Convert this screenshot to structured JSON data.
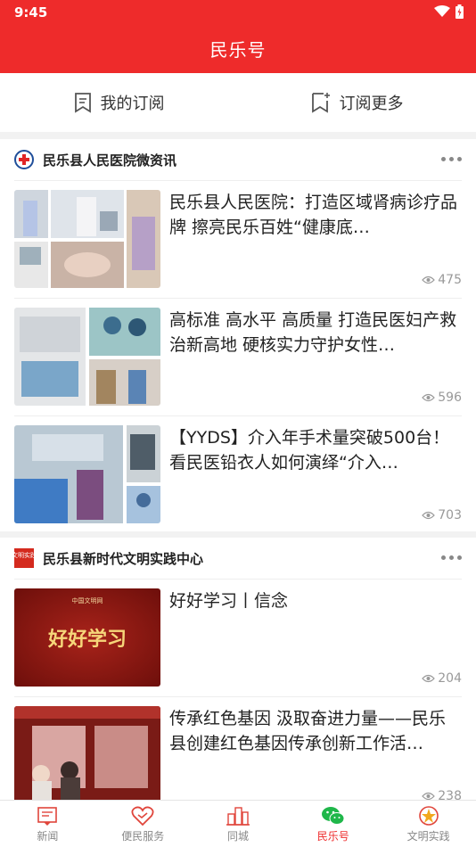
{
  "status": {
    "time": "9:45"
  },
  "header": {
    "title": "民乐号"
  },
  "subscriptions": {
    "mine": "我的订阅",
    "more": "订阅更多"
  },
  "sections": [
    {
      "name": "民乐县人民医院微资讯",
      "articles": [
        {
          "title": "民乐县人民医院：打造区域肾病诊疗品牌 擦亮民乐百姓“健康底…",
          "views": "475"
        },
        {
          "title": "高标准 高水平 高质量 打造民医妇产救治新高地 硬核实力守护女性…",
          "views": "596"
        },
        {
          "title": "【YYDS】介入年手术量突破500台！看民医铅衣人如何演绎“介入…",
          "views": "703"
        }
      ]
    },
    {
      "name": "民乐县新时代文明实践中心",
      "logo_text": "文明实践",
      "articles": [
        {
          "title": "好好学习丨信念",
          "views": "204",
          "thumb_text": "好好学习",
          "thumb_small": "中国文明网"
        },
        {
          "title": "传承红色基因 汲取奋进力量——民乐县创建红色基因传承创新工作活…",
          "views": "238"
        }
      ]
    }
  ],
  "nav": [
    {
      "label": "新闻",
      "icon": "news-icon"
    },
    {
      "label": "便民服务",
      "icon": "heart-handshake-icon"
    },
    {
      "label": "同城",
      "icon": "city-icon"
    },
    {
      "label": "民乐号",
      "icon": "wechat-icon",
      "active": true
    },
    {
      "label": "文明实践",
      "icon": "civilization-icon"
    }
  ],
  "colors": {
    "brand": "#ee2b2b",
    "text": "#222222",
    "muted": "#999999"
  }
}
